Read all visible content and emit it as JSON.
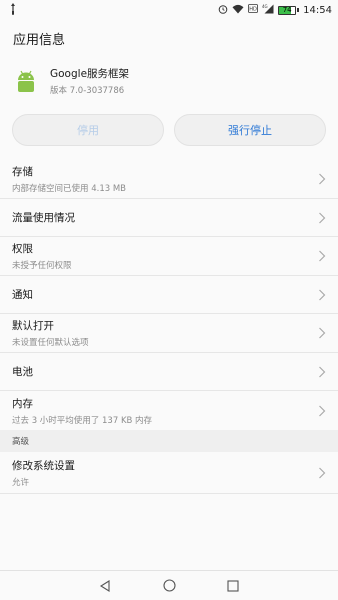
{
  "status_bar": {
    "left_icon": "usb-icon",
    "icons": [
      "alarm-icon",
      "wifi-icon",
      "hd-icon",
      "signal-4g-icon"
    ],
    "battery_level": "74",
    "time": "14:54"
  },
  "header": {
    "title": "应用信息"
  },
  "app": {
    "icon": "android-icon",
    "name": "Google服务框架",
    "version": "版本 7.0-3037786"
  },
  "actions": {
    "disable_label": "停用",
    "force_stop_label": "强行停止"
  },
  "items": [
    {
      "title": "存储",
      "subtitle": "内部存储空间已使用 4.13 MB"
    },
    {
      "title": "流量使用情况"
    },
    {
      "title": "权限",
      "subtitle": "未授予任何权限"
    },
    {
      "title": "通知"
    },
    {
      "title": "默认打开",
      "subtitle": "未设置任何默认选项"
    },
    {
      "title": "电池"
    },
    {
      "title": "内存",
      "subtitle": "过去 3 小时平均使用了 137 KB 内存"
    }
  ],
  "advanced": {
    "header": "高级",
    "items": [
      {
        "title": "修改系统设置",
        "subtitle": "允许"
      }
    ]
  },
  "nav": {
    "icons": [
      "back-icon",
      "home-icon",
      "recents-icon"
    ]
  },
  "colors": {
    "accent": "#2f7ad6",
    "disabled_text": "#b6cde8",
    "android_green": "#8bc34a",
    "battery_green": "#3cbf4a"
  }
}
